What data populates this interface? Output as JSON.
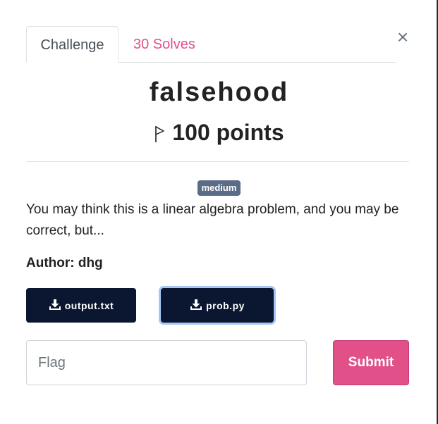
{
  "tabs": [
    {
      "label": "Challenge",
      "active": true
    },
    {
      "label": "30 Solves",
      "active": false
    }
  ],
  "close_label": "×",
  "challenge": {
    "name": "falsehood",
    "points": "100 points",
    "difficulty": "medium",
    "description": "You may think this is a linear algebra problem, and you may be correct, but...",
    "author": "Author: dhg"
  },
  "files": [
    {
      "name": "output.txt",
      "icon": "download-icon"
    },
    {
      "name": "prob.py",
      "icon": "download-icon"
    }
  ],
  "flag_form": {
    "placeholder": "Flag",
    "value": "",
    "submit_label": "Submit"
  },
  "colors": {
    "accent": "#e2508a",
    "file_button": "#0b1730",
    "badge": "#5b6c86"
  }
}
